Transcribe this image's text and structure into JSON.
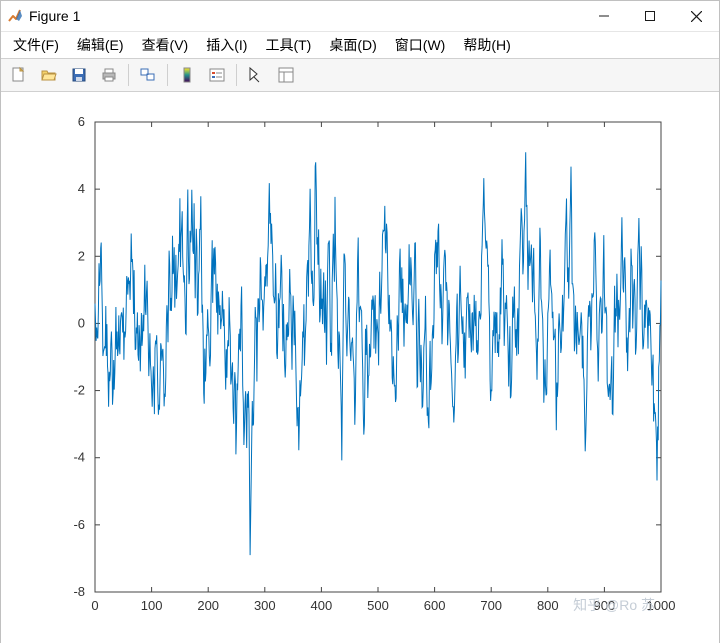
{
  "window": {
    "title": "Figure 1"
  },
  "menu": {
    "file": "文件(F)",
    "edit": "编辑(E)",
    "view": "查看(V)",
    "insert": "插入(I)",
    "tools": "工具(T)",
    "desktop": "桌面(D)",
    "window": "窗口(W)",
    "help": "帮助(H)"
  },
  "watermark": "知乎 @Ro 苏",
  "chart_data": {
    "type": "line",
    "title": "",
    "xlabel": "",
    "ylabel": "",
    "xlim": [
      0,
      1000
    ],
    "ylim": [
      -8,
      6
    ],
    "xticks": [
      0,
      100,
      200,
      300,
      400,
      500,
      600,
      700,
      800,
      900,
      1000
    ],
    "yticks": [
      -8,
      -6,
      -4,
      -2,
      0,
      2,
      4,
      6
    ],
    "grid": false,
    "legend": null,
    "x": "0:1000",
    "values_note": "Noisy signal, mean≈0, std≈1.5, min≈-6.9 at x≈283, max≈5.1 at x≈765",
    "values": [
      0.59,
      -0.01,
      -0.52,
      -0.12,
      -0.4,
      -0.45,
      0.37,
      1.79,
      1.12,
      1.27,
      2.24,
      2.41,
      1.17,
      0.28,
      -0.97,
      -0.83,
      -0.77,
      -0.68,
      -0.74,
      0.52,
      -0.97,
      -0.02,
      -1.27,
      -1.49,
      -2.48,
      -1.44,
      -1.72,
      -1.52,
      -0.62,
      -0.24,
      -0.81,
      -2.42,
      -2.07,
      -1.09,
      -1.97,
      -1.48,
      -0.6,
      0.49,
      -0.77,
      -0.24,
      -0.97,
      -0.8,
      0.24,
      -0.67,
      -0.92,
      0.07,
      0.24,
      0.33,
      0.18,
      -0.27,
      0.47,
      -1.08,
      -0.24,
      -0.42,
      -0.25,
      0.34,
      1.41,
      1.27,
      0.86,
      1.37,
      1.17,
      1.27,
      0.7,
      1.63,
      2.68,
      1.83,
      1.92,
      1.57,
      0.28,
      1.59,
      0.26,
      -0.79,
      -0.75,
      -0.12,
      -0.3,
      0.33,
      -0.93,
      -1.11,
      -0.05,
      -0.41,
      -1.43,
      -0.68,
      0.31,
      -0.67,
      -0.46,
      0.26,
      -0.23,
      0.57,
      1.75,
      0.39,
      0.25,
      0.93,
      1.27,
      0.51,
      -0.42,
      -1.57,
      -1.09,
      -0.29,
      -1.22,
      -1.42,
      -1.92,
      -2.48,
      -1.9,
      -1.28,
      -1.85,
      -2.7,
      -0.74,
      -0.51,
      -0.62,
      -0.35,
      -1.13,
      -2.05,
      -2.72,
      -2.42,
      -2.57,
      -1.62,
      -0.59,
      -0.67,
      -1.11,
      -0.83,
      -0.76,
      -1.38,
      -2.47,
      -2.09,
      -2.19,
      -1.6,
      -0.11,
      0.54,
      0.22,
      -0.56,
      1.1,
      2.17,
      1.73,
      0.38,
      0.76,
      0.37,
      0.95,
      2.61,
      1.47,
      1.58,
      2.27,
      0.47,
      1.22,
      2.04,
      0.73,
      1.13,
      1.47,
      1.75,
      2.37,
      2.13,
      3.73,
      1.68,
      2.56,
      2.86,
      3.34,
      1.98,
      1.52,
      1.22,
      1.43,
      0.73,
      -0.3,
      -0.32,
      1.36,
      3.14,
      3.99,
      2.02,
      1.17,
      1.33,
      2.76,
      2.41,
      2.66,
      3.98,
      3.01,
      2.17,
      2.07,
      3.58,
      2.09,
      0.75,
      1.87,
      2.82,
      2.28,
      0.23,
      0.31,
      1.46,
      1.58,
      2.8,
      2.8,
      3.79,
      2.16,
      0.32,
      0.56,
      -0.23,
      -2.08,
      -2.39,
      -0.75,
      -1.73,
      -1.47,
      -0.35,
      -0.36,
      0.42,
      -0.1,
      -0.31,
      -0.96,
      -1.28,
      -0.96,
      0.66,
      1.53,
      2.48,
      0.61,
      1.84,
      2.24,
      1.46,
      2.28,
      1.81,
      0.85,
      0.32,
      1.18,
      -0.33,
      0.95,
      0.66,
      0.25,
      0.54,
      -0.17,
      0.03,
      0.17,
      0.97,
      0.46,
      -0.08,
      0.42,
      -0.48,
      -1.34,
      -1.97,
      -0.77,
      -1.62,
      -0.74,
      -0.5,
      -0.68,
      0.78,
      0.08,
      -0.37,
      -1.82,
      -1.67,
      -1.31,
      -1.16,
      -2.53,
      -2.99,
      -2.04,
      -1.45,
      -1.73,
      -3.9,
      -3.11,
      -1.79,
      -1.99,
      -1.27,
      -0.31,
      -0.78,
      -0.16,
      -0.83,
      0.52,
      1.1,
      -0.45,
      -1.85,
      -2.35,
      -3.62,
      -3.18,
      -2.41,
      -2.02,
      -2.73,
      -3.71,
      -2.09,
      -2.51,
      -2.02,
      -2.72,
      -4.62,
      -6.9,
      -5.67,
      -4.63,
      -3.28,
      -2.31,
      -3.04,
      -3.0,
      -1.98,
      -0.97,
      0.49,
      0.2,
      0.15,
      -1.73,
      -0.23,
      0.73,
      0.73,
      0.04,
      0.43,
      1.97,
      1.7,
      0.72,
      0.71,
      0.67,
      -0.21,
      0.49,
      0.76,
      1.4,
      1.1,
      1.73,
      1.75,
      1.1,
      1.95,
      2.32,
      3.39,
      4.18,
      2.97,
      3.29,
      2.37,
      2.97,
      2.42,
      2.02,
      0.83,
      0.77,
      0.6,
      0.71,
      1.79,
      0.97,
      -0.88,
      -1.06,
      -0.38,
      0.9,
      -0.14,
      0.67,
      0.78,
      1.31,
      2.04,
      1.56,
      0.42,
      -0.83,
      0.58,
      -0.29,
      -1.22,
      -1.61,
      -1.24,
      -0.03,
      -0.5,
      0.03,
      -0.4,
      -0.33,
      0.48,
      1.62,
      0.94,
      0.84,
      -0.27,
      -1.38,
      -0.14,
      0.83,
      0.35,
      -0.65,
      0.38,
      -0.44,
      -1.34,
      -2.26,
      -3.06,
      -2.54,
      -2.49,
      -3.78,
      -3.02,
      -1.69,
      -2.17,
      -1.88,
      -1.58,
      -1.05,
      -0.24,
      -0.42,
      0.57,
      -1.26,
      -0.68,
      -0.15,
      0.1,
      1.38,
      1.74,
      1.89,
      0.8,
      2.31,
      2.85,
      4.01,
      3.09,
      1.5,
      1.18,
      1.57,
      0.67,
      0.52,
      0.77,
      2.04,
      4.68,
      4.8,
      3.96,
      2.35,
      2.57,
      1.75,
      2.8,
      1.45,
      0.03,
      0.27,
      1.63,
      0.43,
      0.74,
      -0.02,
      0.83,
      1.52,
      0.02,
      -0.28,
      1.28,
      0.35,
      -1.23,
      0.31,
      1.57,
      2.37,
      2.42,
      2.47,
      0.73,
      -0.85,
      -0.58,
      -0.96,
      1.27,
      1.8,
      2.67,
      1.9,
      1.24,
      3.77,
      2.37,
      1.57,
      1.03,
      0.71,
      -0.81,
      -1.35,
      -0.24,
      -0.37,
      -1.15,
      -1.73,
      -2.46,
      -4.08,
      -2.26,
      -0.91,
      0.83,
      2.08,
      2.03,
      1.77,
      0.39,
      -0.3,
      -0.98,
      -0.33,
      0.16,
      0.79,
      0.71,
      -0.43,
      -0.85,
      -1.12,
      -0.58,
      -0.56,
      -0.42,
      -0.94,
      -1.28,
      -1.64,
      -3.02,
      -2.33,
      -1.17,
      0.27,
      0.63,
      1.88,
      2.56,
      0.7,
      0.04,
      0.47,
      0.5,
      0.42,
      0.38,
      -0.74,
      -1.36,
      -2.68,
      -3.31,
      -3.03,
      -1.5,
      -0.16,
      -0.94,
      -0.04,
      -0.82,
      -2.22,
      -1.57,
      -1.55,
      -0.61,
      -1.01,
      -0.97,
      -0.13,
      0.71,
      0.41,
      0.83,
      0.67,
      -0.75,
      0.5,
      0.84,
      -0.9,
      -0.29,
      0.13,
      -0.07,
      -0.3,
      -1.25,
      0.21,
      1.54,
      0.57,
      0.29,
      0.89,
      1.59,
      2.64,
      2.77,
      2.75,
      2.77,
      3.5,
      2.24,
      2.09,
      2.97,
      2.71,
      1.7,
      0.56,
      -0.02,
      0.85,
      -0.24,
      -0.1,
      0.11,
      -0.26,
      -1.62,
      -1.81,
      -0.98,
      -1.47,
      -1.88,
      -1.83,
      -2.34,
      -2.23,
      -0.95,
      0.24,
      -0.12,
      -0.81,
      0.48,
      1.8,
      2.23,
      1.07,
      0.62,
      1.67,
      0.31,
      1.33,
      0.14,
      -0.69,
      0.37,
      0.59,
      0.13,
      0.01,
      0.56,
      -0.01,
      0.56,
      1.17,
      2.36,
      1.18,
      1.16,
      1.97,
      1.59,
      0.76,
      0.29,
      -0.05,
      0.67,
      1.35,
      2.39,
      2.4,
      1.02,
      -0.3,
      -1.9,
      -1.88,
      0.03,
      0.73,
      0.05,
      -1.22,
      -1.75,
      -0.64,
      -1.21,
      -2.5,
      -2.47,
      -1.86,
      -0.72,
      -0.47,
      -0.14,
      0.82,
      -0.48,
      -1.88,
      -2.75,
      -2.5,
      -2.94,
      -3.12,
      -1.37,
      -0.52,
      -1.98,
      -1.77,
      -1.34,
      -0.35,
      -0.05,
      -0.45,
      0.16,
      2.05,
      2.19,
      2.49,
      1.47,
      2.42,
      1.67,
      2.75,
      2.97,
      1.79,
      0.97,
      0.45,
      1.17,
      0.77,
      -0.62,
      -0.14,
      0.72,
      1.62,
      1.95,
      2.19,
      2.0,
      0.97,
      1.23,
      0.92,
      -0.65,
      -0.18,
      0.7,
      0.56,
      -0.26,
      -0.6,
      -1.17,
      -1.5,
      -1.98,
      -2.48,
      -2.48,
      -2.95,
      -2.56,
      -1.81,
      -0.97,
      -0.6,
      0.47,
      0.89,
      -1.18,
      -0.89,
      -0.28,
      0.83,
      1.72,
      0.96,
      0.41,
      -0.02,
      -0.31,
      0.21,
      -0.66,
      -1.32,
      -0.27,
      -1.64,
      -0.64,
      0.08,
      0.77,
      0.77,
      0.92,
      0.34,
      -0.43,
      0.58,
      -0.1,
      -0.5,
      -0.86,
      0.29,
      0.33,
      -0.81,
      -0.11,
      0.85,
      0.15,
      -0.08,
      0.67,
      -0.87,
      -0.5,
      -0.93,
      -0.8,
      0.09,
      0.37,
      0.27,
      0.12,
      0.27,
      2.01,
      2.3,
      3.04,
      3.56,
      4.33,
      3.33,
      2.97,
      2.47,
      2.23,
      2.47,
      2.29,
      1.69,
      1.75,
      0.64,
      0.17,
      -1.7,
      -2.31,
      -1.97,
      -2.02,
      -1.02,
      -0.2,
      -0.38,
      0.35,
      0.17,
      -0.88,
      0.34,
      -0.29,
      0.33,
      -0.88,
      -0.54,
      -1.0,
      -0.32,
      -0.47,
      1.07,
      0.27,
      1.31,
      2.51,
      1.75,
      1.93,
      0.62,
      -0.67,
      -0.01,
      0.62,
      0.43,
      0.84,
      0.35,
      -0.15,
      -0.93,
      -1.88,
      -0.85,
      -0.08,
      -2.23,
      -2.16,
      -1.66,
      -0.82,
      0.8,
      0.17,
      0.4,
      1.1,
      -0.17,
      -0.72,
      -0.17,
      -0.96,
      0.02,
      0.45,
      -0.92,
      0.11,
      1.72,
      2.28,
      2.8,
      3.43,
      3.16,
      2.73,
      1.46,
      1.84,
      2.75,
      3.09,
      4.3,
      5.1,
      3.47,
      3.53,
      2.36,
      1.0,
      2.03,
      2.47,
      1.71,
      1.82,
      2.04,
      2.35,
      1.47,
      0.63,
      1.72,
      2.25,
      0.93,
      0.35,
      0.22,
      -0.38,
      -0.9,
      -1.68,
      -0.45,
      -0.54,
      0.36,
      1.38,
      2.85,
      2.46,
      0.75,
      0.64,
      0.36,
      0.13,
      -0.82,
      -2.36,
      -1.84,
      -1.07,
      -1.85,
      -2.14,
      -2.1,
      -0.94,
      0.3,
      0.47,
      0.73,
      1.69,
      2.2,
      1.16,
      1.03,
      0.88,
      0.16,
      0.35,
      -0.5,
      -0.42,
      -0.38,
      -0.16,
      -1.5,
      -3.18,
      -1.76,
      -2.19,
      -1.79,
      -0.04,
      0.3,
      -0.08,
      -0.33,
      -0.88,
      -0.73,
      0.08,
      0.85,
      -0.24,
      0.33,
      0.84,
      1.74,
      2.66,
      3.07,
      3.72,
      2.31,
      1.23,
      1.67,
      0.74,
      1.73,
      2.95,
      3.57,
      4.67,
      3.3,
      1.18,
      1.18,
      1.03,
      0.84,
      -0.83,
      -0.56,
      0.53,
      -0.05,
      -0.92,
      0.34,
      -0.08,
      -0.38,
      -0.64,
      -0.5,
      -0.3,
      -0.05,
      0.33,
      -0.03,
      -1.34,
      -0.37,
      -1.56,
      -1.67,
      -2.68,
      -3.81,
      -3.39,
      -2.68,
      -1.89,
      -0.5,
      0.14,
      0.54,
      0.2,
      0.67,
      0.47,
      -0.8,
      -0.2,
      0.9,
      0.78,
      0.8,
      0.92,
      2.47,
      2.71,
      2.41,
      1.47,
      0.73,
      -0.48,
      -0.74,
      -1.73,
      -0.89,
      0.28,
      0.62,
      0.77,
      0.73,
      -0.3,
      -0.24,
      0.43,
      1.74,
      2.63,
      0.93,
      0.3,
      0.45,
      0.47,
      0.21,
      -1.77,
      -1.95,
      -2.19,
      -1.88,
      -1.8,
      -2.28,
      -1.97,
      -1.42,
      -0.98,
      -2.69,
      -2.71,
      -1.62,
      -0.28,
      1.12,
      -0.27,
      0.45,
      0.21,
      1.48,
      0.77,
      -0.71,
      0.7,
      0.38,
      0.11,
      0.56,
      1.22,
      2.38,
      3.16,
      2.04,
      1.05,
      0.92,
      1.86,
      1.97,
      1.44,
      0.53,
      -0.87,
      -0.42,
      -1.42,
      -0.5,
      -0.18,
      0.46,
      -0.26,
      0.45,
      2.23,
      1.73,
      1.72,
      -0.15,
      0.45,
      1.14,
      1.32,
      0.72,
      -0.93,
      -0.73,
      -0.15,
      0.94,
      2.04,
      2.5,
      3.14,
      2.15,
      0.41,
      1.3,
      2.3,
      1.58,
      -0.08,
      -0.77,
      -0.66,
      -0.29,
      0.56,
      -0.13,
      0.66,
      0.7,
      0.47,
      0.12,
      -0.75,
      0.47,
      -0.07,
      0.39,
      0.26,
      -0.44,
      -1.22,
      -1.85,
      -1.26,
      -0.93,
      -2.92,
      -2.38,
      -2.69,
      -2.64,
      -3.02,
      -3.56,
      -4.68,
      -3.07,
      -3.48,
      -1.3,
      -1.12,
      -0.07,
      -0.01,
      1.28
    ]
  }
}
